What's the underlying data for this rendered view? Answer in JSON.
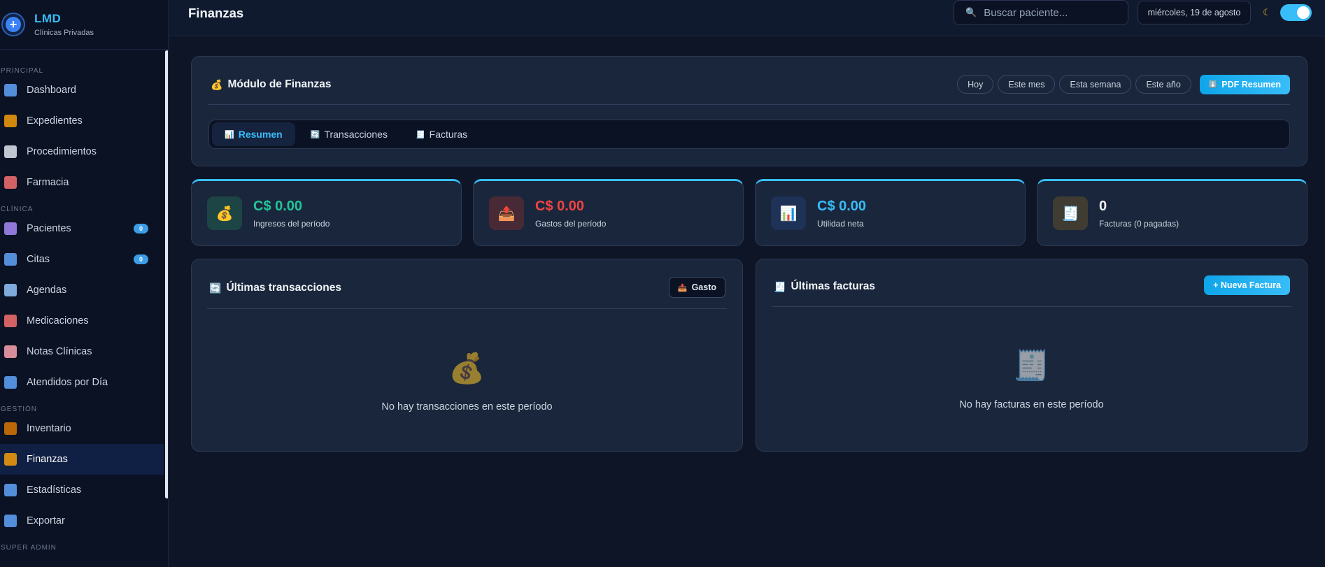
{
  "brand": {
    "name": "LMD",
    "subtitle": "Clínicas Privadas"
  },
  "sidebar": {
    "sections": [
      {
        "label": "PRINCIPAL",
        "items": [
          {
            "label": "Dashboard",
            "icon": "bar-chart-icon",
            "color": "#60a5fa"
          },
          {
            "label": "Expedientes",
            "icon": "clipboard-icon",
            "color": "#f59e0b"
          },
          {
            "label": "Procedimientos",
            "icon": "tooth-icon",
            "color": "#e2e8f0"
          },
          {
            "label": "Farmacia",
            "icon": "pill-icon",
            "color": "#f87171"
          }
        ]
      },
      {
        "label": "CLÍNICA",
        "items": [
          {
            "label": "Pacientes",
            "icon": "people-icon",
            "color": "#a78bfa",
            "badge": "0"
          },
          {
            "label": "Citas",
            "icon": "calendar-icon",
            "color": "#60a5fa",
            "badge": "0"
          },
          {
            "label": "Agendas",
            "icon": "calendar-icon",
            "color": "#93c5fd"
          },
          {
            "label": "Medicaciones",
            "icon": "pill-icon",
            "color": "#f87171"
          },
          {
            "label": "Notas Clínicas",
            "icon": "note-icon",
            "color": "#fda4af"
          },
          {
            "label": "Atendidos por Día",
            "icon": "bar-chart-icon",
            "color": "#60a5fa"
          }
        ]
      },
      {
        "label": "GESTIÓN",
        "items": [
          {
            "label": "Inventario",
            "icon": "box-icon",
            "color": "#d97706"
          },
          {
            "label": "Finanzas",
            "icon": "money-bag-icon",
            "color": "#f59e0b",
            "active": true
          },
          {
            "label": "Estadísticas",
            "icon": "trend-chart-icon",
            "color": "#60a5fa"
          },
          {
            "label": "Exportar",
            "icon": "outbox-icon",
            "color": "#60a5fa"
          }
        ]
      },
      {
        "label": "SUPER ADMIN",
        "items": []
      }
    ]
  },
  "topbar": {
    "title": "Finanzas",
    "search_placeholder": "Buscar paciente...",
    "date": "miércoles, 19 de agosto"
  },
  "module": {
    "title": "Módulo de Finanzas",
    "periods": [
      "Hoy",
      "Este mes",
      "Esta semana",
      "Este año"
    ],
    "pdf_label": "PDF Resumen",
    "tabs": [
      {
        "label": "Resumen",
        "icon": "bar-chart-icon",
        "active": true
      },
      {
        "label": "Transacciones",
        "icon": "refresh-icon"
      },
      {
        "label": "Facturas",
        "icon": "receipt-icon"
      }
    ]
  },
  "stats": [
    {
      "value": "C$ 0.00",
      "label": "Ingresos del período",
      "icon": "money-bag-icon",
      "value_color": "#22c59a",
      "icon_bg": "#1d4545"
    },
    {
      "value": "C$ 0.00",
      "label": "Gastos del período",
      "icon": "outbox-icon",
      "value_color": "#ef4444",
      "icon_bg": "#472a36"
    },
    {
      "value": "C$ 0.00",
      "label": "Utilidad neta",
      "icon": "bar-chart-icon",
      "value_color": "#38bdf8",
      "icon_bg": "#1e3157"
    },
    {
      "value": "0",
      "label": "Facturas (0 pagadas)",
      "icon": "receipt-icon",
      "value_color": "#f1f5f9",
      "icon_bg": "#413c32"
    }
  ],
  "transactions": {
    "title": "Últimas transacciones",
    "button": "Gasto",
    "empty": "No hay transacciones en este período"
  },
  "invoices": {
    "title": "Últimas facturas",
    "button": "+ Nueva Factura",
    "empty": "No hay facturas en este período"
  }
}
